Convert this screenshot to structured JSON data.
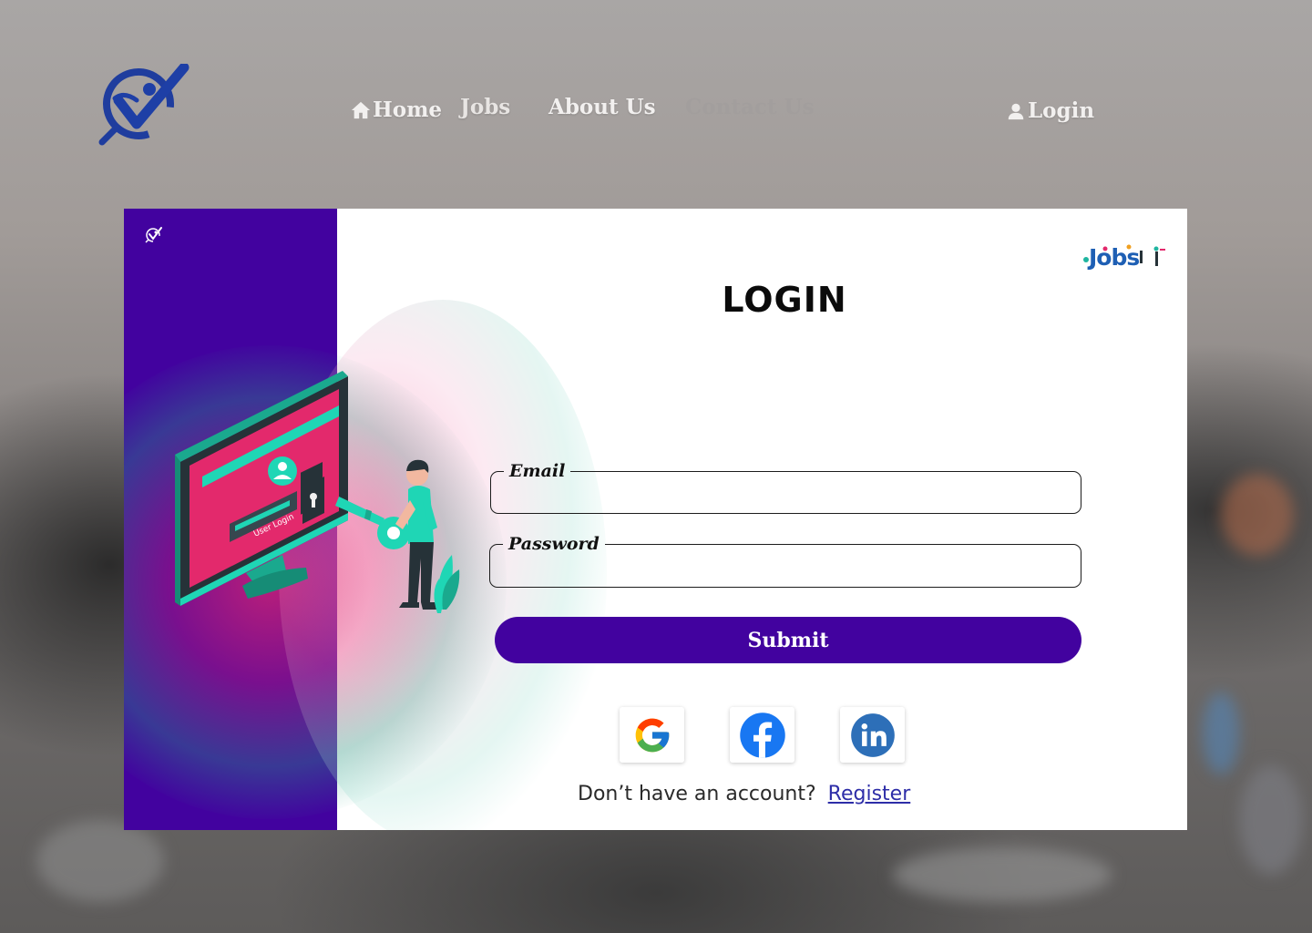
{
  "nav": {
    "items": [
      {
        "label": "Home",
        "icon": "home-icon"
      },
      {
        "label": "Jobs"
      },
      {
        "label": "About Us"
      },
      {
        "label": "Contact Us"
      }
    ],
    "login": {
      "label": "Login",
      "icon": "user-icon"
    }
  },
  "card": {
    "title": "LOGIN",
    "form": {
      "email_label": "Email",
      "email_value": "",
      "password_label": "Password",
      "password_value": "",
      "submit_label": "Submit"
    },
    "illustration_text": "User Login",
    "social": [
      "google-icon",
      "facebook-icon",
      "linkedin-icon"
    ],
    "signup": {
      "text": "Don’t have an account?",
      "link": "Register"
    }
  },
  "colors": {
    "accent": "#42029f",
    "link": "#2e2ea8",
    "brand_blue": "#1e3fa6",
    "teal": "#1fd6b5"
  }
}
